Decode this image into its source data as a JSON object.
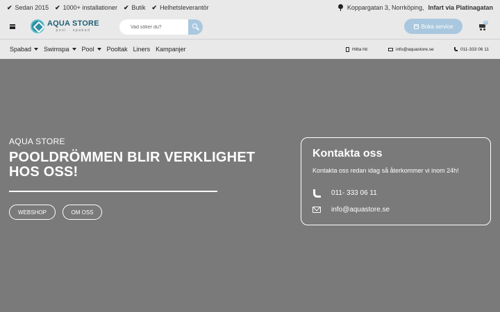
{
  "topbar": {
    "usps": [
      "Sedan 2015",
      "1000+ installationer",
      "Butik",
      "Helhetsleverantör"
    ],
    "address_text": "Koppargatan 3, Norrköping,",
    "address_bold": "Infart via Platinagatan"
  },
  "header": {
    "logo_title": "AQUA STORE",
    "logo_sub": "pool · spabad",
    "search_placeholder": "Vad söker du?",
    "service_button": "Boka service",
    "cart_count": "0"
  },
  "nav": {
    "items": [
      {
        "label": "Spabad",
        "dropdown": true
      },
      {
        "label": "Swimspa",
        "dropdown": true
      },
      {
        "label": "Pool",
        "dropdown": true
      },
      {
        "label": "Pooltak",
        "dropdown": false
      },
      {
        "label": "Liners",
        "dropdown": false
      },
      {
        "label": "Kampanjer",
        "dropdown": false
      }
    ],
    "find_us": "Hitta hit",
    "email": "info@aquastore.se",
    "phone": "011-333 06 11"
  },
  "hero": {
    "kicker": "AQUA STORE",
    "title": "POOLDRÖMMEN BLIR VERKLIGHET HOS OSS!",
    "btn_webshop": "WEBSHOP",
    "btn_om": "OM OSS"
  },
  "contact": {
    "title": "Kontakta oss",
    "subtitle": "Kontakta oss redan idag så återkommer vi inom 24h!",
    "phone": "011- 333 06 11",
    "email": "info@aquastore.se"
  },
  "colors": {
    "bar_bg": "#e9e9ea",
    "accent": "#a9c8df",
    "hero_bg": "#7a7a7a"
  }
}
